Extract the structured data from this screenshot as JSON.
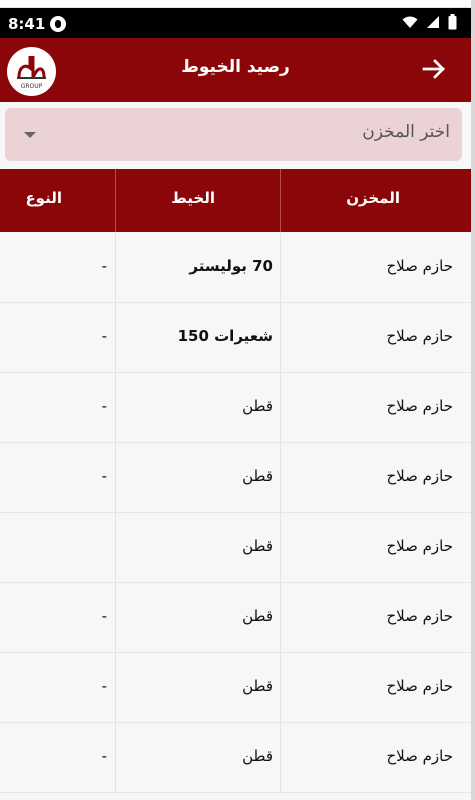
{
  "status_bar": {
    "time": "8:41",
    "icons": [
      "notification-icon",
      "wifi-icon",
      "signal-icon",
      "battery-icon"
    ]
  },
  "app_bar": {
    "title": "رصيد الخيوط",
    "logo_text": "GROUP",
    "back_icon": "arrow-right-icon",
    "background_color": "#8b0609"
  },
  "dropdown": {
    "selected_label": "اختر المخزن",
    "icon": "chevron-down-icon",
    "background_color": "#ead2d5"
  },
  "table": {
    "columns": {
      "store": "المخزن",
      "thread": "الخيط",
      "type": "النوع"
    },
    "rows": [
      {
        "store": "حازم صلاح",
        "thread": "70 بوليستر",
        "type": "-"
      },
      {
        "store": "حازم صلاح",
        "thread": "شعيرات 150",
        "type": "-"
      },
      {
        "store": "حازم صلاح",
        "thread": "قطن",
        "type": "-"
      },
      {
        "store": "حازم صلاح",
        "thread": "قطن",
        "type": "-"
      },
      {
        "store": "حازم صلاح",
        "thread": "قطن",
        "type": ""
      },
      {
        "store": "حازم صلاح",
        "thread": "قطن",
        "type": "-"
      },
      {
        "store": "حازم صلاح",
        "thread": "قطن",
        "type": "-"
      },
      {
        "store": "حازم صلاح",
        "thread": "قطن",
        "type": "-"
      }
    ]
  }
}
